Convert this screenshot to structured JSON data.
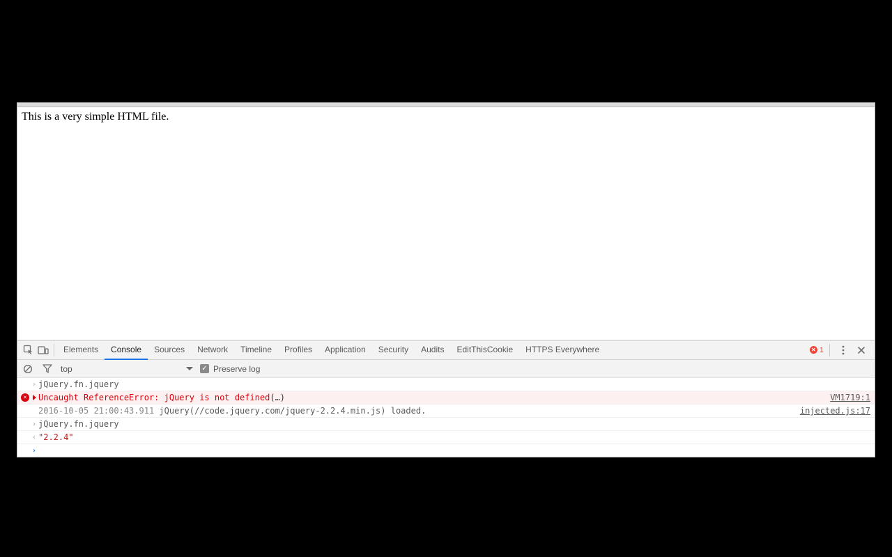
{
  "page": {
    "body_text": "This is a very simple HTML file."
  },
  "devtools": {
    "tabs": {
      "elements": "Elements",
      "console": "Console",
      "sources": "Sources",
      "network": "Network",
      "timeline": "Timeline",
      "profiles": "Profiles",
      "application": "Application",
      "security": "Security",
      "audits": "Audits",
      "editthiscookie": "EditThisCookie",
      "httpseverywhere": "HTTPS Everywhere"
    },
    "active_tab": "console",
    "error_count": "1",
    "subbar": {
      "context": "top",
      "preserve_label": "Preserve log",
      "preserve_checked": true
    },
    "console_rows": [
      {
        "kind": "input",
        "text": "jQuery.fn.jquery"
      },
      {
        "kind": "error",
        "text": "Uncaught ReferenceError: jQuery is not defined",
        "paren": "(…)",
        "source": "VM1719:1"
      },
      {
        "kind": "log",
        "ts": "2016-10-05 21:00:43.911",
        "text": " jQuery(//code.jquery.com/jquery-2.2.4.min.js) loaded.",
        "source": "injected.js:17"
      },
      {
        "kind": "input",
        "text": "jQuery.fn.jquery"
      },
      {
        "kind": "output",
        "text": "\"2.2.4\""
      }
    ]
  }
}
